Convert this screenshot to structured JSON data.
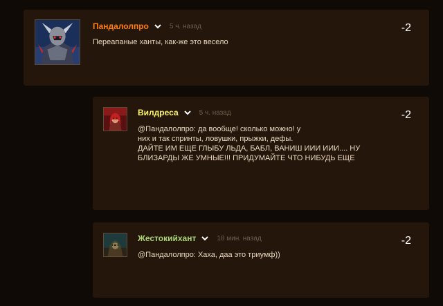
{
  "comments": [
    {
      "author": "Пандалолпро",
      "author_color": "#ff7d0a",
      "time": "5 ч. назад",
      "score": "-2",
      "avatar_icon": "armored-warrior-avatar",
      "lines": [
        "Переапаные ханты, как-же это весело"
      ]
    },
    {
      "author": "Вилдреса",
      "author_color": "#fff569",
      "time": "5 ч. назад",
      "score": "-2",
      "avatar_icon": "female-character-avatar",
      "lines": [
        "@Пандалолпро: да вообще! сколько можно! у",
        "них и так спринты, ловушки, прыжки, дефы.",
        "ДАЙТЕ ИМ ЕЩЕ ГЛЫБУ ЛЬДА, БАБЛ, ВАНИШ ИИИ ИИИ.... НУ",
        "БЛИЗАРДЫ ЖЕ УМНЫЕ!!! ПРИДУМАЙТЕ ЧТО НИБУДЬ ЕЩЕ"
      ]
    },
    {
      "author": "Жестокийхант",
      "author_color": "#abd473",
      "time": "18 мин. назад",
      "score": "-2",
      "avatar_icon": "hooded-hunter-avatar",
      "lines": [
        "@Пандалолпро: Хаха, даа это триумф))"
      ]
    }
  ]
}
